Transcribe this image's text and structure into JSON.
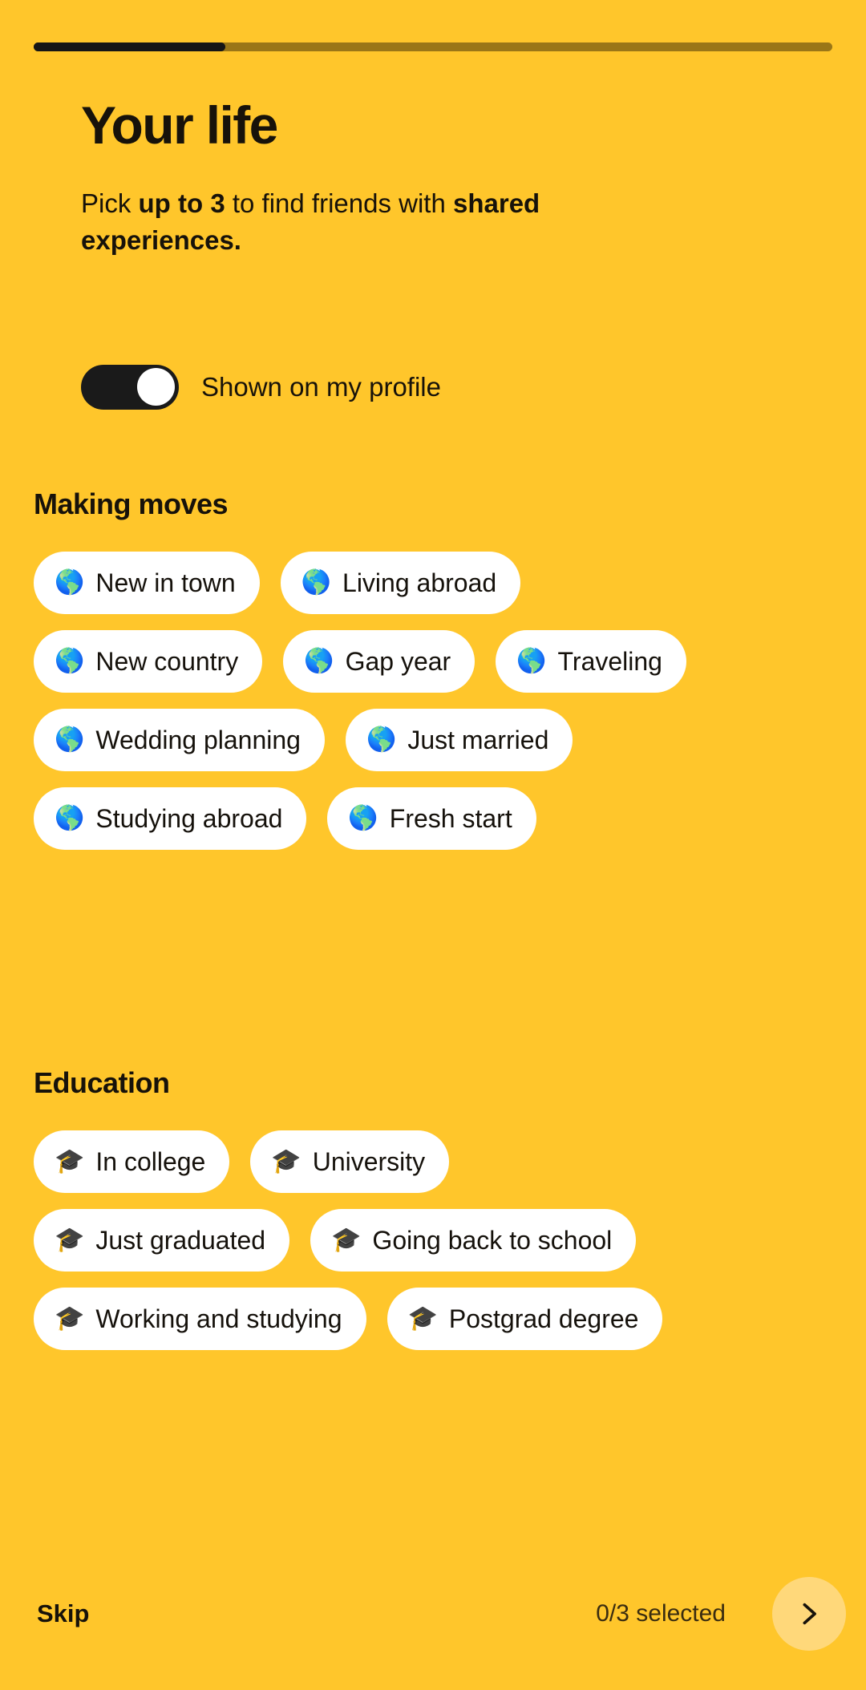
{
  "theme": {
    "background": "#FFC62B",
    "chip_background": "#FFFFFF",
    "text": "#17120A",
    "progress_fill": "#161616",
    "progress_track": "#9A7617",
    "next_button_bg": "#FFD87A"
  },
  "progress": {
    "percent": 24,
    "label": "onboarding-progress"
  },
  "header": {
    "title": "Your life",
    "subtitle_part1": "Pick ",
    "subtitle_bold1": "up to 3",
    "subtitle_part2": " to find friends with ",
    "subtitle_bold2": "shared experiences."
  },
  "visibility_toggle": {
    "label": "Shown on my profile",
    "state": "on"
  },
  "sections": [
    {
      "title": "Making moves",
      "emoji": "🌎",
      "emoji_name": "globe-americas-icon",
      "rows": [
        [
          "New in town",
          "Living abroad"
        ],
        [
          "New country",
          "Gap year",
          "Traveling"
        ],
        [
          "Wedding planning",
          "Just married"
        ],
        [
          "Studying abroad",
          "Fresh start"
        ]
      ]
    },
    {
      "title": "Education",
      "emoji": "🎓",
      "emoji_name": "graduation-cap-icon",
      "rows": [
        [
          "In college",
          "University"
        ],
        [
          "Just graduated",
          "Going back to school"
        ],
        [
          "Working and studying",
          "Postgrad degree"
        ]
      ]
    }
  ],
  "footer": {
    "skip_label": "Skip",
    "counter": "0/3 selected",
    "next_icon": "chevron-right-icon"
  }
}
